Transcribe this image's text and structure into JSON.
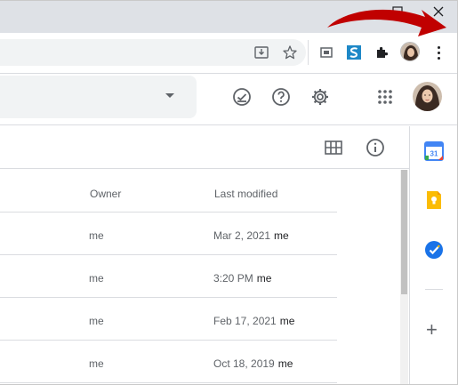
{
  "window": {
    "maximize_glyph": "☐",
    "close_glyph": "✕"
  },
  "browser_toolbar": {
    "icons": [
      "download-icon",
      "bookmark-star-icon",
      "screenshot-extension-icon",
      "s-extension-icon",
      "extensions-puzzle-icon",
      "profile-avatar",
      "chrome-menu-icon"
    ]
  },
  "app_header": {
    "icons": [
      "offline-check-icon",
      "help-icon",
      "settings-gear-icon",
      "apps-grid-icon",
      "account-avatar"
    ]
  },
  "subbar": {
    "icons": [
      "grid-view-icon",
      "info-icon"
    ]
  },
  "side_panel": {
    "items": [
      "calendar-icon",
      "keep-icon",
      "tasks-icon"
    ],
    "calendar_day": "31",
    "add_glyph": "+"
  },
  "table": {
    "columns": {
      "owner": "Owner",
      "last_modified": "Last modified"
    },
    "rows": [
      {
        "owner": "me",
        "date": "Mar 2, 2021",
        "modified_by": "me"
      },
      {
        "owner": "me",
        "date": "3:20 PM",
        "modified_by": "me"
      },
      {
        "owner": "me",
        "date": "Feb 17, 2021",
        "modified_by": "me"
      },
      {
        "owner": "me",
        "date": "Oct 18, 2019",
        "modified_by": "me"
      }
    ]
  },
  "colors": {
    "arrow": "#c00000",
    "calendar_blue": "#4285f4",
    "keep_yellow": "#fbbc04",
    "tasks_blue": "#1a73e8"
  }
}
